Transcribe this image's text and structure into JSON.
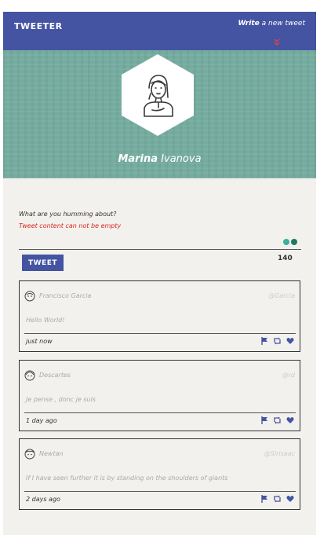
{
  "navbar": {
    "brand": "TWEETER",
    "write_bold": "Write",
    "write_rest": " a new tweet",
    "chevron_icon": "double-chevron-down"
  },
  "profile": {
    "first_name": "Marina",
    "last_name": "Ivanova",
    "avatar_icon": "user-line-art"
  },
  "composer": {
    "prompt": "What are you humming about?",
    "error": "Tweet content can not be empty",
    "button_label": "TWEET",
    "counter": "140",
    "indicator_icons": [
      "light-green-dot",
      "dark-green-dot"
    ]
  },
  "tweets": [
    {
      "author": "Francisco Garcia",
      "handle": "@Garcia",
      "content": "Hello World!",
      "time": "just now"
    },
    {
      "author": "Descartes",
      "handle": "@rd",
      "content": "Je pense , donc je suis",
      "time": "1 day ago"
    },
    {
      "author": "Newtan",
      "handle": "@Sirisaac",
      "content": "If I have seen further it is by standing on the shoulders of giants",
      "time": "2 days ago"
    }
  ],
  "colors": {
    "navbar": "#4454a2",
    "hero": "#75ac9f",
    "background": "#f3f1ed",
    "error": "#d9231f",
    "action_icons": "#4454a2"
  }
}
